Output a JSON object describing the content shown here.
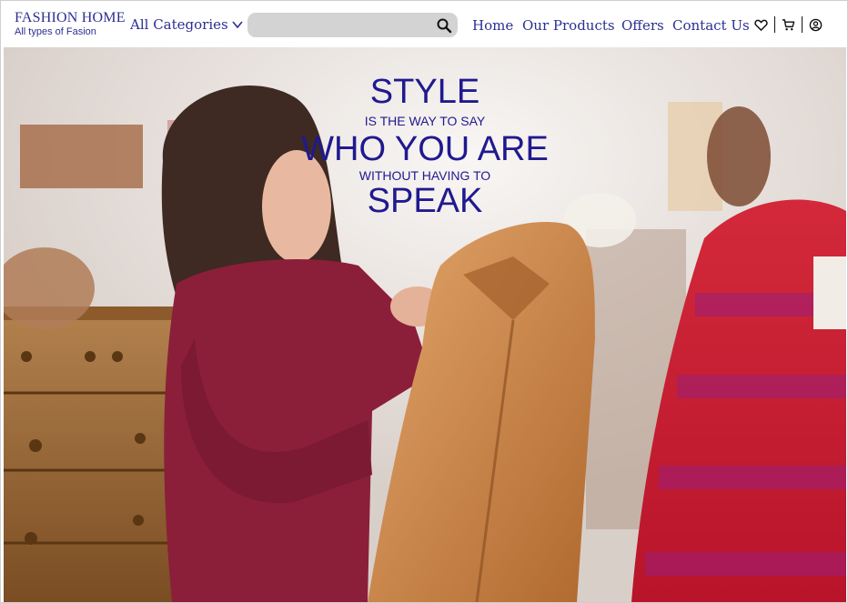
{
  "brand": {
    "name": "FASHION HOME",
    "tagline": "All types of Fasion"
  },
  "categories": {
    "label": "All Categories",
    "icon": "chevron-down-icon"
  },
  "search": {
    "value": "",
    "placeholder": "",
    "icon": "search-icon"
  },
  "nav": {
    "items": [
      {
        "label": "Home"
      },
      {
        "label": "Our Products"
      },
      {
        "label": "Offers"
      },
      {
        "label": "Contact Us"
      }
    ]
  },
  "header_icons": [
    "heart-icon",
    "cart-icon",
    "user-icon"
  ],
  "hero": {
    "line1": "STYLE",
    "line2": "IS THE WAY TO SAY",
    "line3": "WHO YOU ARE",
    "line4": "WITHOUT HAVING TO",
    "line5": "SPEAK"
  },
  "colors": {
    "brand": "#2b2f91",
    "hero_text": "#20198f",
    "search_bg": "#d3d3d3"
  }
}
